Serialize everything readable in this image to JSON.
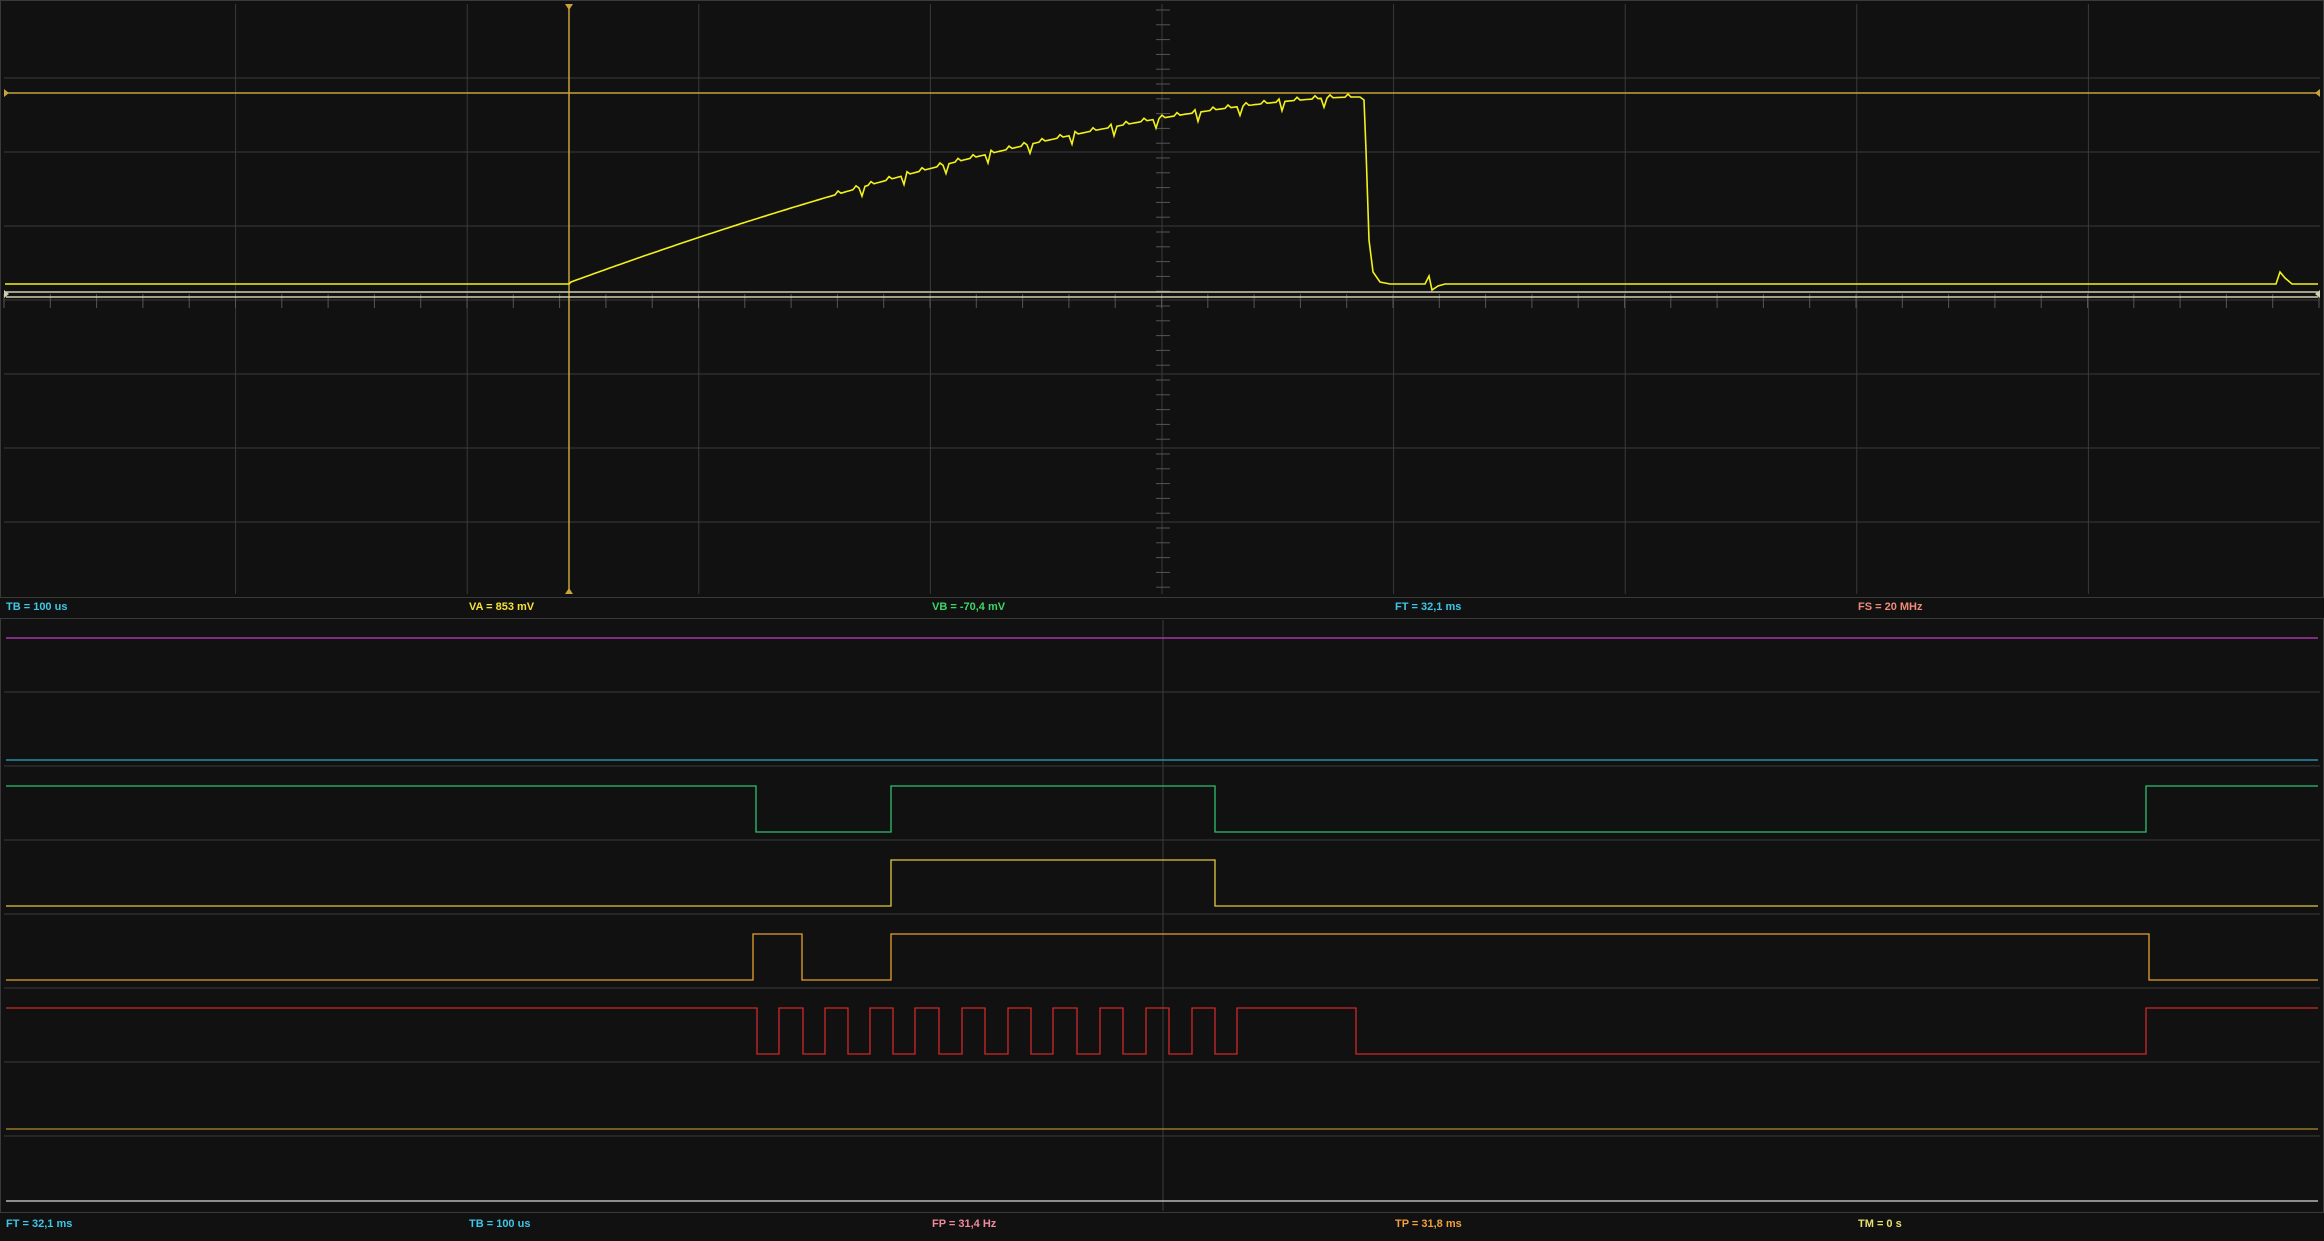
{
  "colors": {
    "background": "#111111",
    "grid": "#3a3a3a",
    "trace_analog": "#f2f21a",
    "cursor": "#c8a23a",
    "ref_line": "#cfd0b0",
    "ch_magenta": "#c23cc2",
    "ch_cyan": "#2aa6c8",
    "ch_green": "#2ebf70",
    "ch_yellow": "#e4c840",
    "ch_orange": "#e8a030",
    "ch_red": "#d02828",
    "ch_gold": "#b08a30",
    "ch_white": "#d8d8d8"
  },
  "status_top": {
    "tb": "TB = 100 us",
    "va": "VA = 853 mV",
    "vb": "VB = -70,4 mV",
    "ft": "FT = 32,1 ms",
    "fs": "FS = 20 MHz"
  },
  "status_bottom": {
    "ft": "FT = 32,1 ms",
    "tb": "TB = 100 us",
    "fp": "FP = 31,4 Hz",
    "tp": "TP = 31,8 ms",
    "tm": "TM = 0 s"
  },
  "footer": {
    "left": "...",
    "right": "..."
  }
}
